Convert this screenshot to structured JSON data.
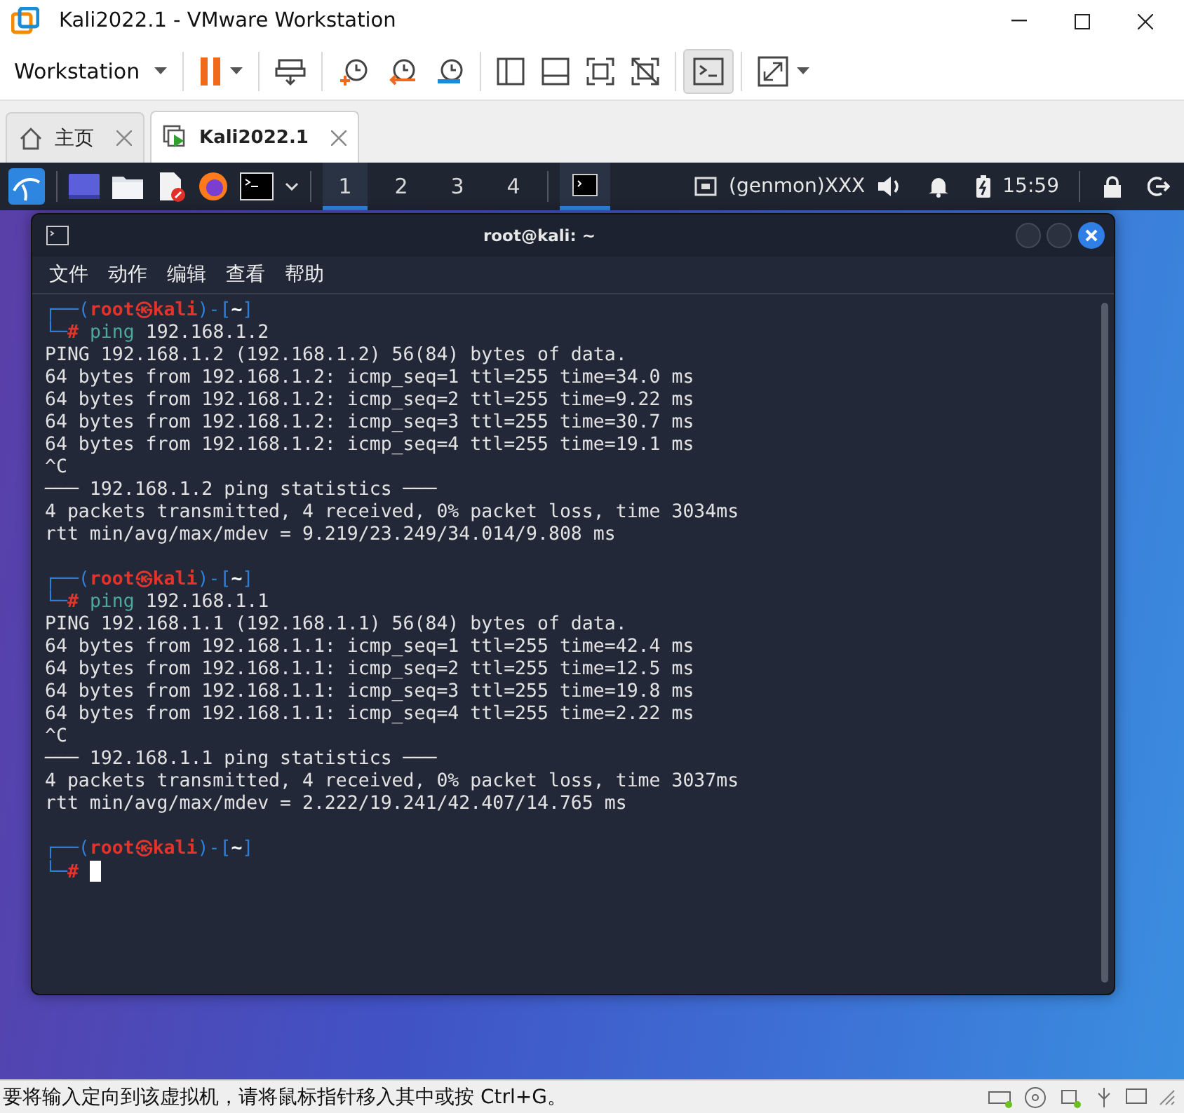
{
  "window": {
    "title": "Kali2022.1 - VMware Workstation"
  },
  "toolbar": {
    "menu_label": "Workstation",
    "console_view": {
      "on": true
    }
  },
  "tabs": [
    {
      "label": "主页",
      "selected": false
    },
    {
      "label": "Kali2022.1",
      "selected": true
    }
  ],
  "vm_panel": {
    "workspaces": [
      {
        "label": "1",
        "selected": true
      },
      {
        "label": "2",
        "selected": false
      },
      {
        "label": "3",
        "selected": false
      },
      {
        "label": "4",
        "selected": false
      }
    ],
    "plugin": "(genmon)XXX",
    "clock": "15:59"
  },
  "terminal": {
    "title": "root@kali: ~",
    "menu": [
      "文件",
      "动作",
      "编辑",
      "查看",
      "帮助"
    ],
    "lines": [
      {
        "kind": "prompt",
        "frame_top": "┌──(",
        "user": "root",
        "at": "㉿",
        "host": "kali",
        "mid": ")-[",
        "dir": "~",
        "end": "]",
        "frame_bottom": "└─",
        "mark": "#",
        "command": "ping",
        "args": "192.168.1.2",
        "cursor": false
      },
      {
        "kind": "output",
        "text": "PING 192.168.1.2 (192.168.1.2) 56(84) bytes of data."
      },
      {
        "kind": "output",
        "text": "64 bytes from 192.168.1.2: icmp_seq=1 ttl=255 time=34.0 ms"
      },
      {
        "kind": "output",
        "text": "64 bytes from 192.168.1.2: icmp_seq=2 ttl=255 time=9.22 ms"
      },
      {
        "kind": "output",
        "text": "64 bytes from 192.168.1.2: icmp_seq=3 ttl=255 time=30.7 ms"
      },
      {
        "kind": "output",
        "text": "64 bytes from 192.168.1.2: icmp_seq=4 ttl=255 time=19.1 ms"
      },
      {
        "kind": "output",
        "text": "^C"
      },
      {
        "kind": "output",
        "text": "─── 192.168.1.2 ping statistics ───"
      },
      {
        "kind": "output",
        "text": "4 packets transmitted, 4 received, 0% packet loss, time 3034ms"
      },
      {
        "kind": "output",
        "text": "rtt min/avg/max/mdev = 9.219/23.249/34.014/9.808 ms"
      },
      {
        "kind": "blank"
      },
      {
        "kind": "prompt",
        "frame_top": "┌──(",
        "user": "root",
        "at": "㉿",
        "host": "kali",
        "mid": ")-[",
        "dir": "~",
        "end": "]",
        "frame_bottom": "└─",
        "mark": "#",
        "command": "ping",
        "args": "192.168.1.1",
        "cursor": false
      },
      {
        "kind": "output",
        "text": "PING 192.168.1.1 (192.168.1.1) 56(84) bytes of data."
      },
      {
        "kind": "output",
        "text": "64 bytes from 192.168.1.1: icmp_seq=1 ttl=255 time=42.4 ms"
      },
      {
        "kind": "output",
        "text": "64 bytes from 192.168.1.1: icmp_seq=2 ttl=255 time=12.5 ms"
      },
      {
        "kind": "output",
        "text": "64 bytes from 192.168.1.1: icmp_seq=3 ttl=255 time=19.8 ms"
      },
      {
        "kind": "output",
        "text": "64 bytes from 192.168.1.1: icmp_seq=4 ttl=255 time=2.22 ms"
      },
      {
        "kind": "output",
        "text": "^C"
      },
      {
        "kind": "output",
        "text": "─── 192.168.1.1 ping statistics ───"
      },
      {
        "kind": "output",
        "text": "4 packets transmitted, 4 received, 0% packet loss, time 3037ms"
      },
      {
        "kind": "output",
        "text": "rtt min/avg/max/mdev = 2.222/19.241/42.407/14.765 ms"
      },
      {
        "kind": "blank"
      },
      {
        "kind": "prompt",
        "frame_top": "┌──(",
        "user": "root",
        "at": "㉿",
        "host": "kali",
        "mid": ")-[",
        "dir": "~",
        "end": "]",
        "frame_bottom": "└─",
        "mark": "#",
        "cursor": true
      }
    ]
  },
  "status_bar": {
    "message": "要将输入定向到该虚拟机，请将鼠标指针移入其中或按 Ctrl+G。"
  }
}
